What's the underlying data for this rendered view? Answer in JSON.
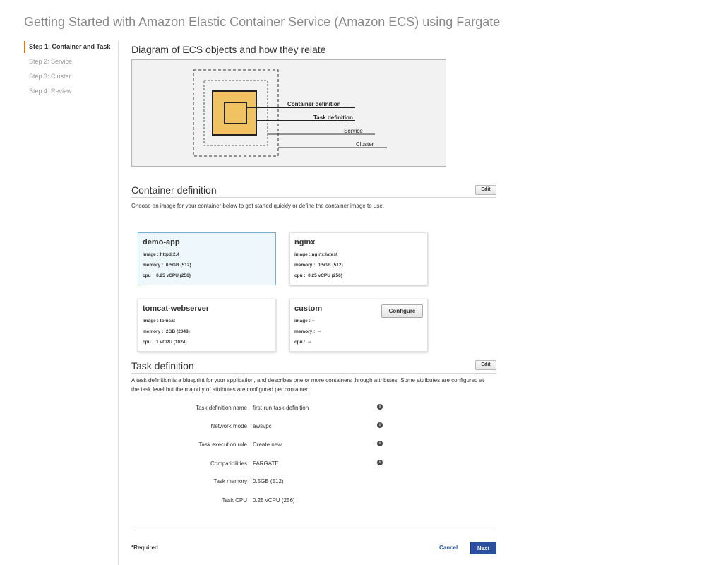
{
  "page_title": "Getting Started with Amazon Elastic Container Service (Amazon ECS) using Fargate",
  "steps": [
    {
      "label": "Step 1: Container and Task",
      "active": true
    },
    {
      "label": "Step 2: Service",
      "active": false
    },
    {
      "label": "Step 3: Cluster",
      "active": false
    },
    {
      "label": "Step 4: Review",
      "active": false
    }
  ],
  "diagram": {
    "heading": "Diagram of ECS objects and how they relate",
    "labels": {
      "container_definition": "Container definition",
      "task_definition": "Task definition",
      "service": "Service",
      "cluster": "Cluster"
    },
    "colors": {
      "task_fill": "#f0c261",
      "line": "#333333"
    }
  },
  "container_definition": {
    "heading": "Container definition",
    "edit_label": "Edit",
    "description": "Choose an image for your container below to get started quickly or define the container image to use.",
    "cards": [
      {
        "name": "demo-app",
        "image": "image : httpd:2.4",
        "memory": "memory :  0.5GB (512)",
        "cpu": "cpu :  0.25 vCPU (256)",
        "selected": true
      },
      {
        "name": "nginx",
        "image": "image : nginx:latest",
        "memory": "memory :  0.5GB (512)",
        "cpu": "cpu :  0.25 vCPU (256)",
        "selected": false
      },
      {
        "name": "tomcat-webserver",
        "image": "image : tomcat",
        "memory": "memory :  2GB (2048)",
        "cpu": "cpu :  1 vCPU (1024)",
        "selected": false
      },
      {
        "name": "custom",
        "image": "image : --",
        "memory": "memory :  --",
        "cpu": "cpu :  --",
        "selected": false,
        "configure_label": "Configure"
      }
    ]
  },
  "task_definition": {
    "heading": "Task definition",
    "edit_label": "Edit",
    "description": "A task definition is a blueprint for your application, and describes one or more containers through attributes. Some attributes are configured at the task level but the majority of attributes are configured per container.",
    "rows": [
      {
        "label": "Task definition name",
        "value": "first-run-task-definition",
        "info": true
      },
      {
        "label": "Network mode",
        "value": "awsvpc",
        "info": true
      },
      {
        "label": "Task execution role",
        "value": "Create new",
        "info": true
      },
      {
        "label": "Compatibilities",
        "value": "FARGATE",
        "info": true
      },
      {
        "label": "Task memory",
        "value": "0.5GB (512)",
        "info": false
      },
      {
        "label": "Task CPU",
        "value": "0.25 vCPU (256)",
        "info": false
      }
    ]
  },
  "footer": {
    "required_label": "*Required",
    "cancel_label": "Cancel",
    "next_label": "Next"
  },
  "colors": {
    "accent_orange": "#e07b00",
    "primary_blue": "#2a4f9e",
    "link_blue": "#2a58a6",
    "selected_bg": "#eef7fc"
  }
}
